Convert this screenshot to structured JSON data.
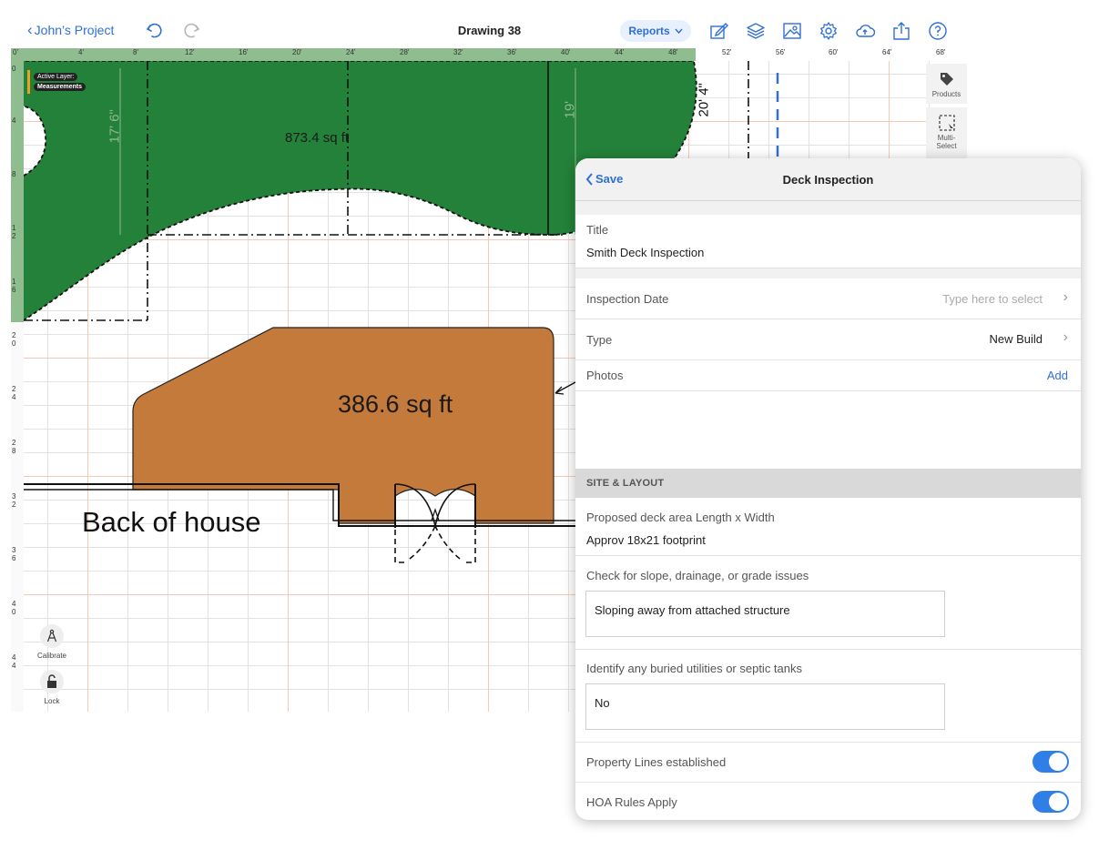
{
  "toolbar": {
    "back_label": "John’s Project",
    "title": "Drawing 38",
    "reports_label": "Reports",
    "icons": [
      "undo-icon",
      "redo-icon",
      "edit-drawing-icon",
      "layers-icon",
      "image-icon",
      "gear-icon",
      "cloud-upload-icon",
      "share-icon",
      "help-icon"
    ]
  },
  "ruler": {
    "labels": [
      "0'",
      "4'",
      "8'",
      "12'",
      "16'",
      "20'",
      "24'",
      "28'",
      "32'",
      "36'",
      "40'",
      "44'",
      "48'",
      "52'",
      "56'",
      "60'",
      "64'",
      "68'"
    ],
    "v_labels": [
      "0",
      "4",
      "8",
      "1 2",
      "1 6",
      "2 0",
      "2 4",
      "2 8",
      "3 2",
      "3 6",
      "4 0",
      "4 4"
    ]
  },
  "canvas": {
    "active_layer_label": "Active Layer:",
    "active_layer_name": "Measurements",
    "green_area_label": "873.4 sq ft",
    "deck_area_label": "386.6 sq ft",
    "house_label": "Back of house",
    "dimension_left": "17' 6\"",
    "dimension_right": "19'",
    "dimension_vertical": "20' 4\"",
    "colors": {
      "lawn": "#238139",
      "deck": "#c47a3a"
    }
  },
  "side_tools": {
    "products_label": "Products",
    "multi_select_label": "Multi-Select"
  },
  "left_tools": {
    "calibrate_label": "Calibrate",
    "lock_label": "Lock"
  },
  "panel": {
    "save_label": "Save",
    "title": "Deck Inspection",
    "title_field_label": "Title",
    "title_field_value": "Smith Deck Inspection",
    "inspection_date_label": "Inspection Date",
    "inspection_date_placeholder": "Type here to select",
    "type_label": "Type",
    "type_value": "New Build",
    "photos_label": "Photos",
    "photos_add_label": "Add",
    "section_site_layout": "SITE & LAYOUT",
    "deck_area_label": "Proposed deck area Length x Width",
    "deck_area_value": "Approv 18x21 footprint",
    "slope_label": "Check for slope, drainage, or grade issues",
    "slope_value": "Sloping away from attached structure",
    "utilities_label": "Identify any buried utilities or septic tanks",
    "utilities_value": "No",
    "property_lines_label": "Property Lines established",
    "property_lines_on": true,
    "hoa_label": "HOA Rules Apply",
    "hoa_on": true,
    "accent_color": "#2f7fe6"
  }
}
